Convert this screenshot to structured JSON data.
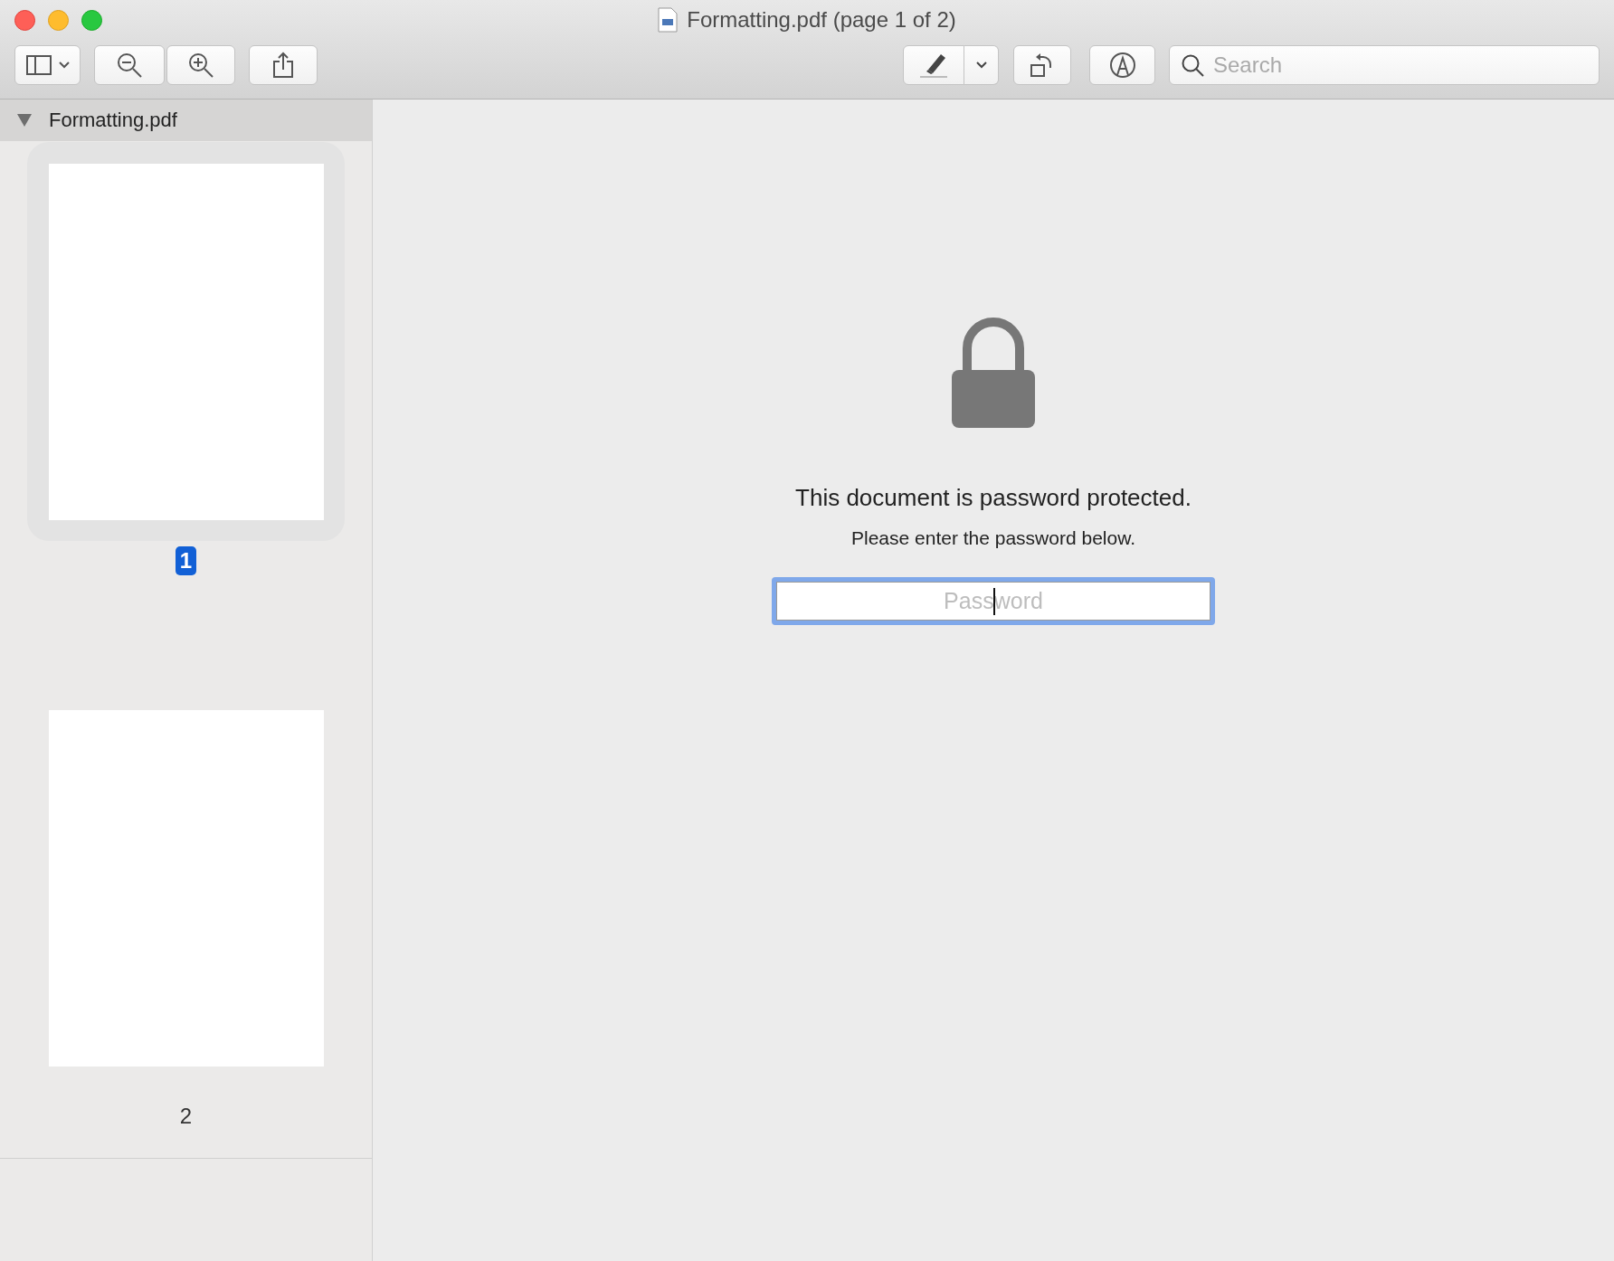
{
  "window": {
    "title": "Formatting.pdf (page 1 of 2)"
  },
  "toolbar": {
    "search": {
      "placeholder": "Search"
    }
  },
  "sidebar": {
    "document": "Formatting.pdf",
    "expanded": true,
    "pages": [
      {
        "label": "1",
        "selected": true
      },
      {
        "label": "2",
        "selected": false
      }
    ]
  },
  "lock_message": {
    "heading": "This document is password protected.",
    "subheading": "Please enter the password below."
  },
  "password_field": {
    "placeholder": "Password",
    "focused": true
  }
}
